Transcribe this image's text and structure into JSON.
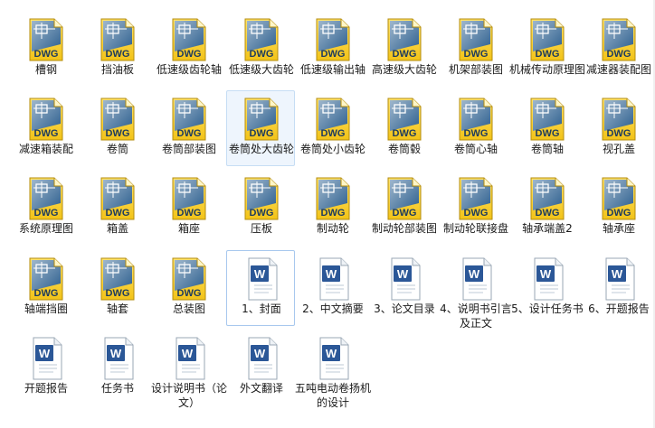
{
  "files": [
    {
      "name": "槽钢",
      "type": "dwg"
    },
    {
      "name": "挡油板",
      "type": "dwg"
    },
    {
      "name": "低速级齿轮轴",
      "type": "dwg"
    },
    {
      "name": "低速级大齿轮",
      "type": "dwg"
    },
    {
      "name": "低速级输出轴",
      "type": "dwg"
    },
    {
      "name": "高速级大齿轮",
      "type": "dwg"
    },
    {
      "name": "机架部装图",
      "type": "dwg"
    },
    {
      "name": "机械传动原理图",
      "type": "dwg"
    },
    {
      "name": "减速器装配图",
      "type": "dwg"
    },
    {
      "name": "减速箱装配",
      "type": "dwg"
    },
    {
      "name": "卷筒",
      "type": "dwg"
    },
    {
      "name": "卷筒部装图",
      "type": "dwg"
    },
    {
      "name": "卷筒处大齿轮",
      "type": "dwg",
      "selected": "light"
    },
    {
      "name": "卷筒处小齿轮",
      "type": "dwg"
    },
    {
      "name": "卷筒毂",
      "type": "dwg"
    },
    {
      "name": "卷筒心轴",
      "type": "dwg"
    },
    {
      "name": "卷筒轴",
      "type": "dwg"
    },
    {
      "name": "视孔盖",
      "type": "dwg"
    },
    {
      "name": "系统原理图",
      "type": "dwg"
    },
    {
      "name": "箱盖",
      "type": "dwg"
    },
    {
      "name": "箱座",
      "type": "dwg"
    },
    {
      "name": "压板",
      "type": "dwg"
    },
    {
      "name": "制动轮",
      "type": "dwg"
    },
    {
      "name": "制动轮部装图",
      "type": "dwg"
    },
    {
      "name": "制动轮联接盘",
      "type": "dwg"
    },
    {
      "name": "轴承端盖2",
      "type": "dwg"
    },
    {
      "name": "轴承座",
      "type": "dwg"
    },
    {
      "name": "轴端挡圈",
      "type": "dwg"
    },
    {
      "name": "轴套",
      "type": "dwg"
    },
    {
      "name": "总装图",
      "type": "dwg"
    },
    {
      "name": "1、封面",
      "type": "doc",
      "selected": "outline"
    },
    {
      "name": "2、中文摘要",
      "type": "doc"
    },
    {
      "name": "3、论文目录",
      "type": "doc"
    },
    {
      "name": "4、说明书引言及正文",
      "type": "doc"
    },
    {
      "name": "5、设计任务书",
      "type": "doc"
    },
    {
      "name": "6、开题报告",
      "type": "doc"
    },
    {
      "name": "开题报告",
      "type": "doc"
    },
    {
      "name": "任务书",
      "type": "doc"
    },
    {
      "name": "设计说明书（论文）",
      "type": "doc"
    },
    {
      "name": "外文翻译",
      "type": "doc"
    },
    {
      "name": "五吨电动卷扬机的设计",
      "type": "doc"
    }
  ],
  "icons": {
    "dwg_badge": "DWG",
    "doc_badge": "W",
    "dwg_yellow": "#f2c318",
    "dwg_blue": "#2d5f8f",
    "doc_blue": "#2b5797"
  }
}
